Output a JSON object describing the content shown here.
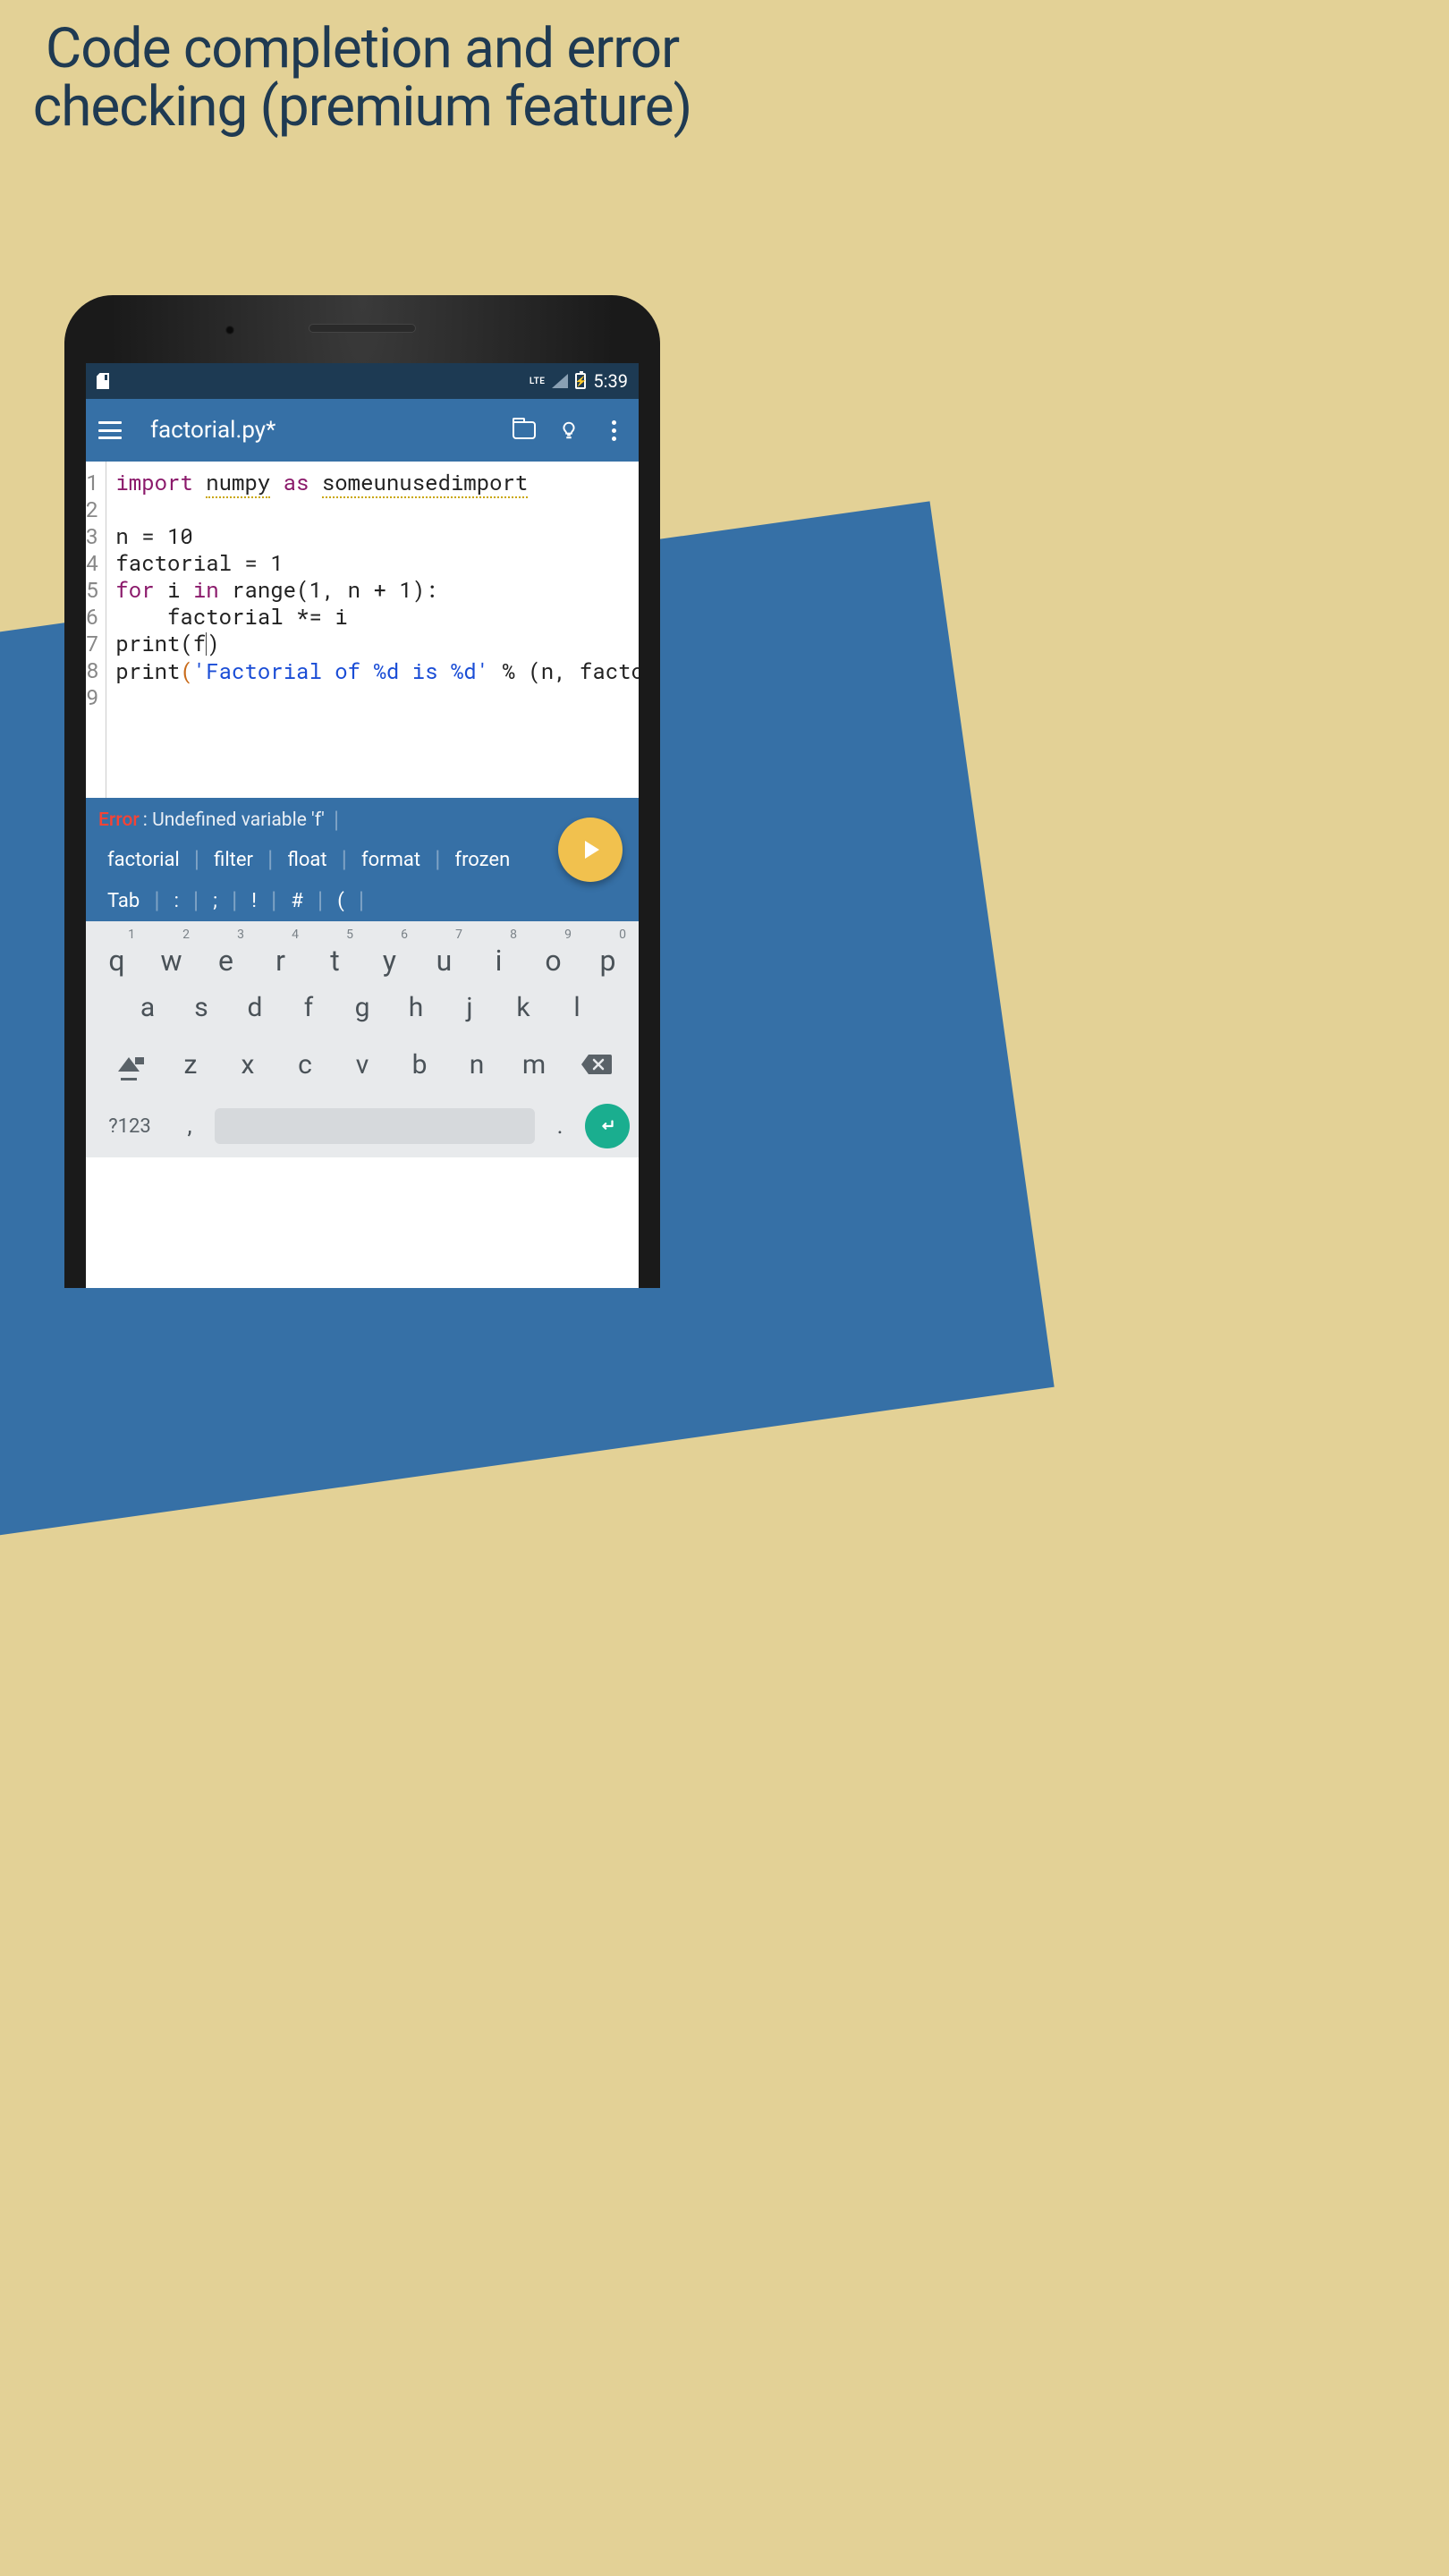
{
  "headline": "Code completion and error checking (premium feature)",
  "status": {
    "lte": "LTE",
    "time": "5:39"
  },
  "appbar": {
    "title": "factorial.py*"
  },
  "code": {
    "lines": [
      "1",
      "2",
      "3",
      "4",
      "5",
      "6",
      "7",
      "8",
      "9"
    ],
    "l1_kw": "import",
    "l1_mod": "numpy",
    "l1_as": "as",
    "l1_alias": "someunusedimport",
    "l3": "n = 10",
    "l4": "factorial = 1",
    "l5_for": "for",
    "l5_i": " i ",
    "l5_in": "in",
    "l5_rest": " range(1, n + 1):",
    "l6": "    factorial *= i",
    "l7_print": "print",
    "l7_lp": "(",
    "l7_f": "f",
    "l7_rp": ")",
    "l8_print": "print",
    "l8_lp": "(",
    "l8_str": "'Factorial of %d is %d'",
    "l8_mid": " % (n, factorial)",
    "l8_rp": ")"
  },
  "error": {
    "label": "Error",
    "text": " : Undefined variable 'f'"
  },
  "suggestions": [
    "factorial",
    "filter",
    "float",
    "format",
    "frozen"
  ],
  "symbols": [
    "Tab",
    ":",
    ";",
    "!",
    "#",
    "("
  ],
  "keyboard": {
    "row1": [
      {
        "k": "q",
        "n": "1"
      },
      {
        "k": "w",
        "n": "2"
      },
      {
        "k": "e",
        "n": "3"
      },
      {
        "k": "r",
        "n": "4"
      },
      {
        "k": "t",
        "n": "5"
      },
      {
        "k": "y",
        "n": "6"
      },
      {
        "k": "u",
        "n": "7"
      },
      {
        "k": "i",
        "n": "8"
      },
      {
        "k": "o",
        "n": "9"
      },
      {
        "k": "p",
        "n": "0"
      }
    ],
    "row2": [
      "a",
      "s",
      "d",
      "f",
      "g",
      "h",
      "j",
      "k",
      "l"
    ],
    "row3": [
      "z",
      "x",
      "c",
      "v",
      "b",
      "n",
      "m"
    ],
    "sym": "?123",
    "comma": ",",
    "period": "."
  }
}
